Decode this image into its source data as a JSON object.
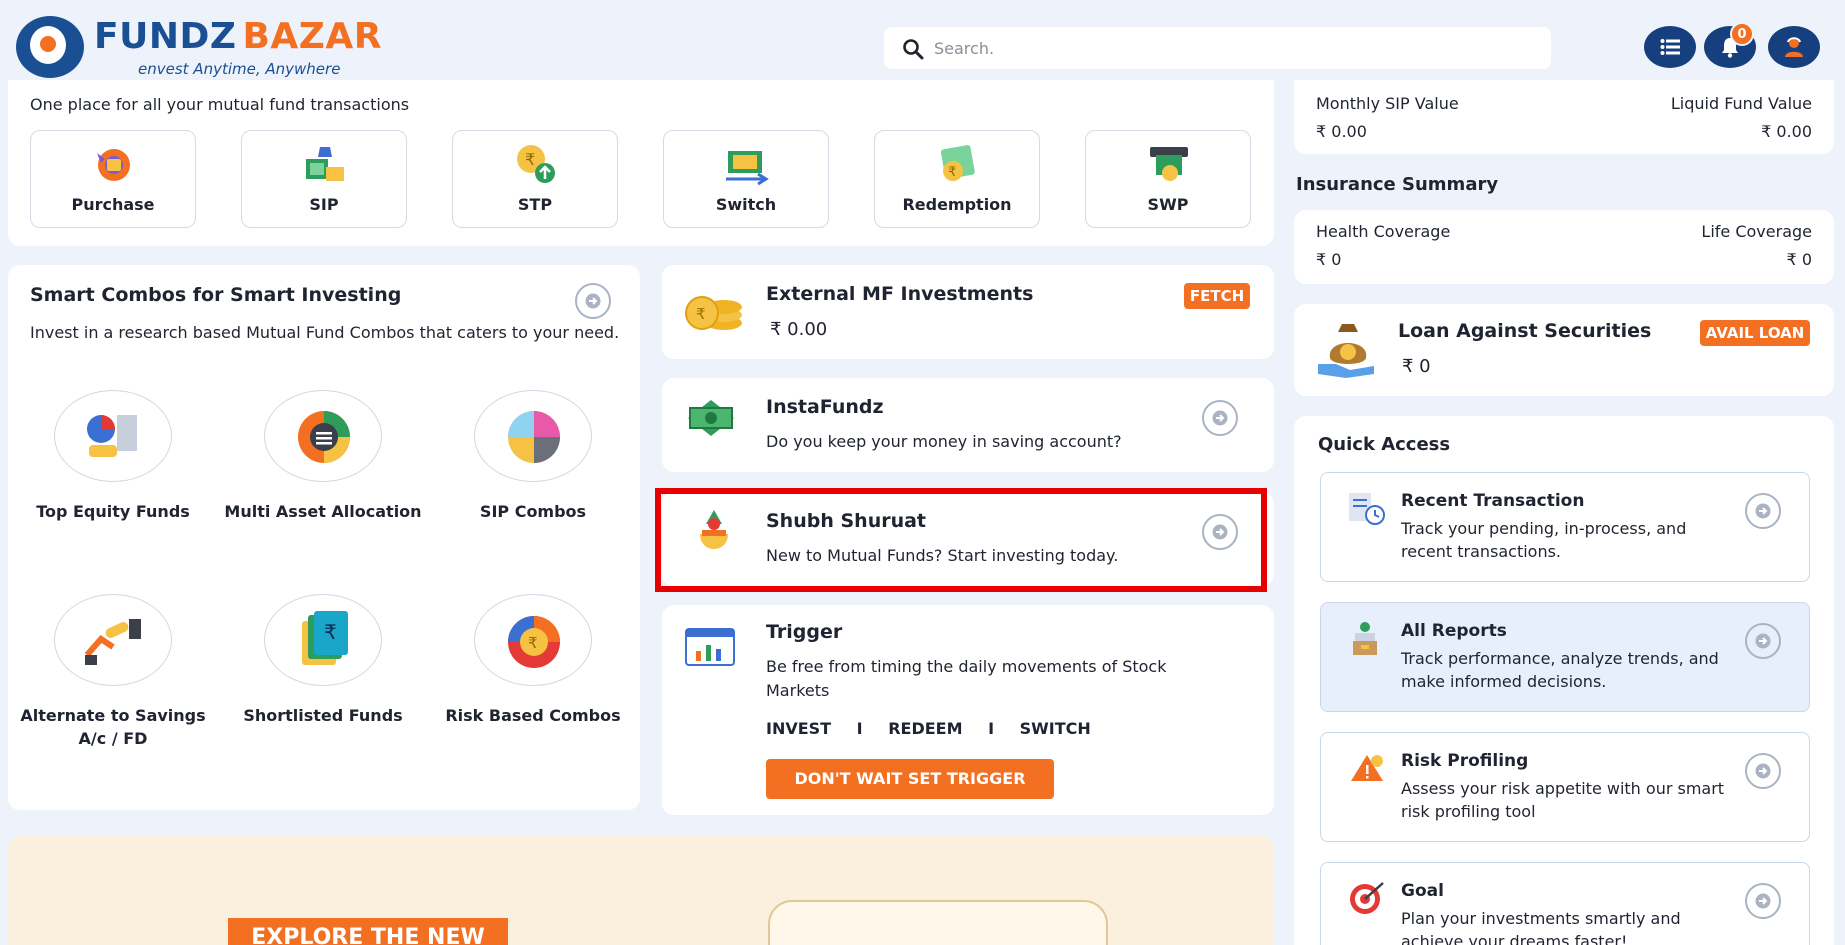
{
  "header": {
    "brand_left": "FUNDZ",
    "brand_right": "BAZAR",
    "tagline": "envest Anytime, Anywhere",
    "search_placeholder": "Search.",
    "notification_count": "0"
  },
  "transactions": {
    "tagline": "One place for all your mutual fund transactions",
    "buttons": [
      {
        "label": "Purchase",
        "icon": "purchase-icon"
      },
      {
        "label": "SIP",
        "icon": "sip-icon"
      },
      {
        "label": "STP",
        "icon": "stp-icon"
      },
      {
        "label": "Switch",
        "icon": "switch-icon"
      },
      {
        "label": "Redemption",
        "icon": "redemption-icon"
      },
      {
        "label": "SWP",
        "icon": "swp-icon"
      }
    ]
  },
  "smart_combos": {
    "title": "Smart Combos for Smart Investing",
    "description": "Invest in a research based Mutual Fund Combos that caters to your need.",
    "items": [
      {
        "label": "Top Equity Funds"
      },
      {
        "label": "Multi Asset Allocation"
      },
      {
        "label": "SIP Combos"
      },
      {
        "label": "Alternate to Savings A/c / FD"
      },
      {
        "label": "Shortlisted Funds"
      },
      {
        "label": "Risk Based Combos"
      }
    ]
  },
  "external_mf": {
    "title": "External MF Investments",
    "value": "₹ 0.00",
    "action": "FETCH"
  },
  "instafundz": {
    "title": "InstaFundz",
    "description": "Do you keep your money in saving account?"
  },
  "shubh_shuruat": {
    "title": "Shubh Shuruat",
    "description": "New to Mutual Funds? Start investing today."
  },
  "trigger": {
    "title": "Trigger",
    "description": "Be free from timing the daily movements of Stock Markets",
    "options": [
      "INVEST",
      "REDEEM",
      "SWITCH"
    ],
    "separator": "I",
    "cta": "DON'T WAIT SET TRIGGER"
  },
  "banner": {
    "text": "EXPLORE THE NEW"
  },
  "sip_summary": {
    "monthly_label": "Monthly SIP Value",
    "monthly_value": "₹ 0.00",
    "liquid_label": "Liquid Fund Value",
    "liquid_value": "₹ 0.00"
  },
  "insurance": {
    "title": "Insurance Summary",
    "health_label": "Health Coverage",
    "health_value": "₹ 0",
    "life_label": "Life Coverage",
    "life_value": "₹ 0"
  },
  "loan": {
    "title": "Loan Against Securities",
    "value": "₹ 0",
    "action": "AVAIL LOAN"
  },
  "quick_access": {
    "title": "Quick Access",
    "items": [
      {
        "title": "Recent Transaction",
        "description": "Track your pending, in-process, and recent transactions."
      },
      {
        "title": "All Reports",
        "description": "Track performance, analyze trends, and make informed decisions."
      },
      {
        "title": "Risk Profiling",
        "description": "Assess your risk appetite with our smart risk profiling tool"
      },
      {
        "title": "Goal",
        "description": "Plan your investments smartly and achieve your dreams faster!"
      }
    ]
  },
  "colors": {
    "brand_blue": "#1b4f94",
    "accent_orange": "#f36f21",
    "highlight_red": "#e60000"
  }
}
